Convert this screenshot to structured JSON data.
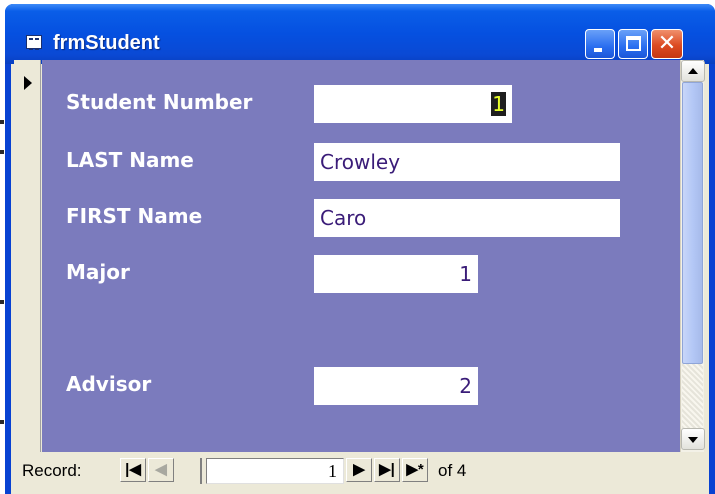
{
  "window": {
    "title": "frmStudent",
    "icons": [
      "form-view-icon",
      "minimize-icon",
      "maximize-icon",
      "close-icon"
    ],
    "colors": {
      "titlebar": "#0550e0",
      "detail": "#7b7bbd",
      "close": "#dc4b22"
    }
  },
  "form": {
    "fields": [
      {
        "label": "Student Number",
        "value": "1",
        "align": "right"
      },
      {
        "label": "LAST Name",
        "value": "Crowley",
        "align": "left"
      },
      {
        "label": "FIRST Name",
        "value": "Caro",
        "align": "left"
      },
      {
        "label": "Major",
        "value": "1",
        "align": "right"
      },
      {
        "label": "Advisor",
        "value": "2",
        "align": "right"
      }
    ]
  },
  "navigation": {
    "label": "Record:",
    "current": "1",
    "of_text": "of 4",
    "buttons": {
      "first": "first-record-icon",
      "prev": "previous-record-icon",
      "next": "next-record-icon",
      "last": "last-record-icon",
      "new": "new-record-icon"
    }
  }
}
